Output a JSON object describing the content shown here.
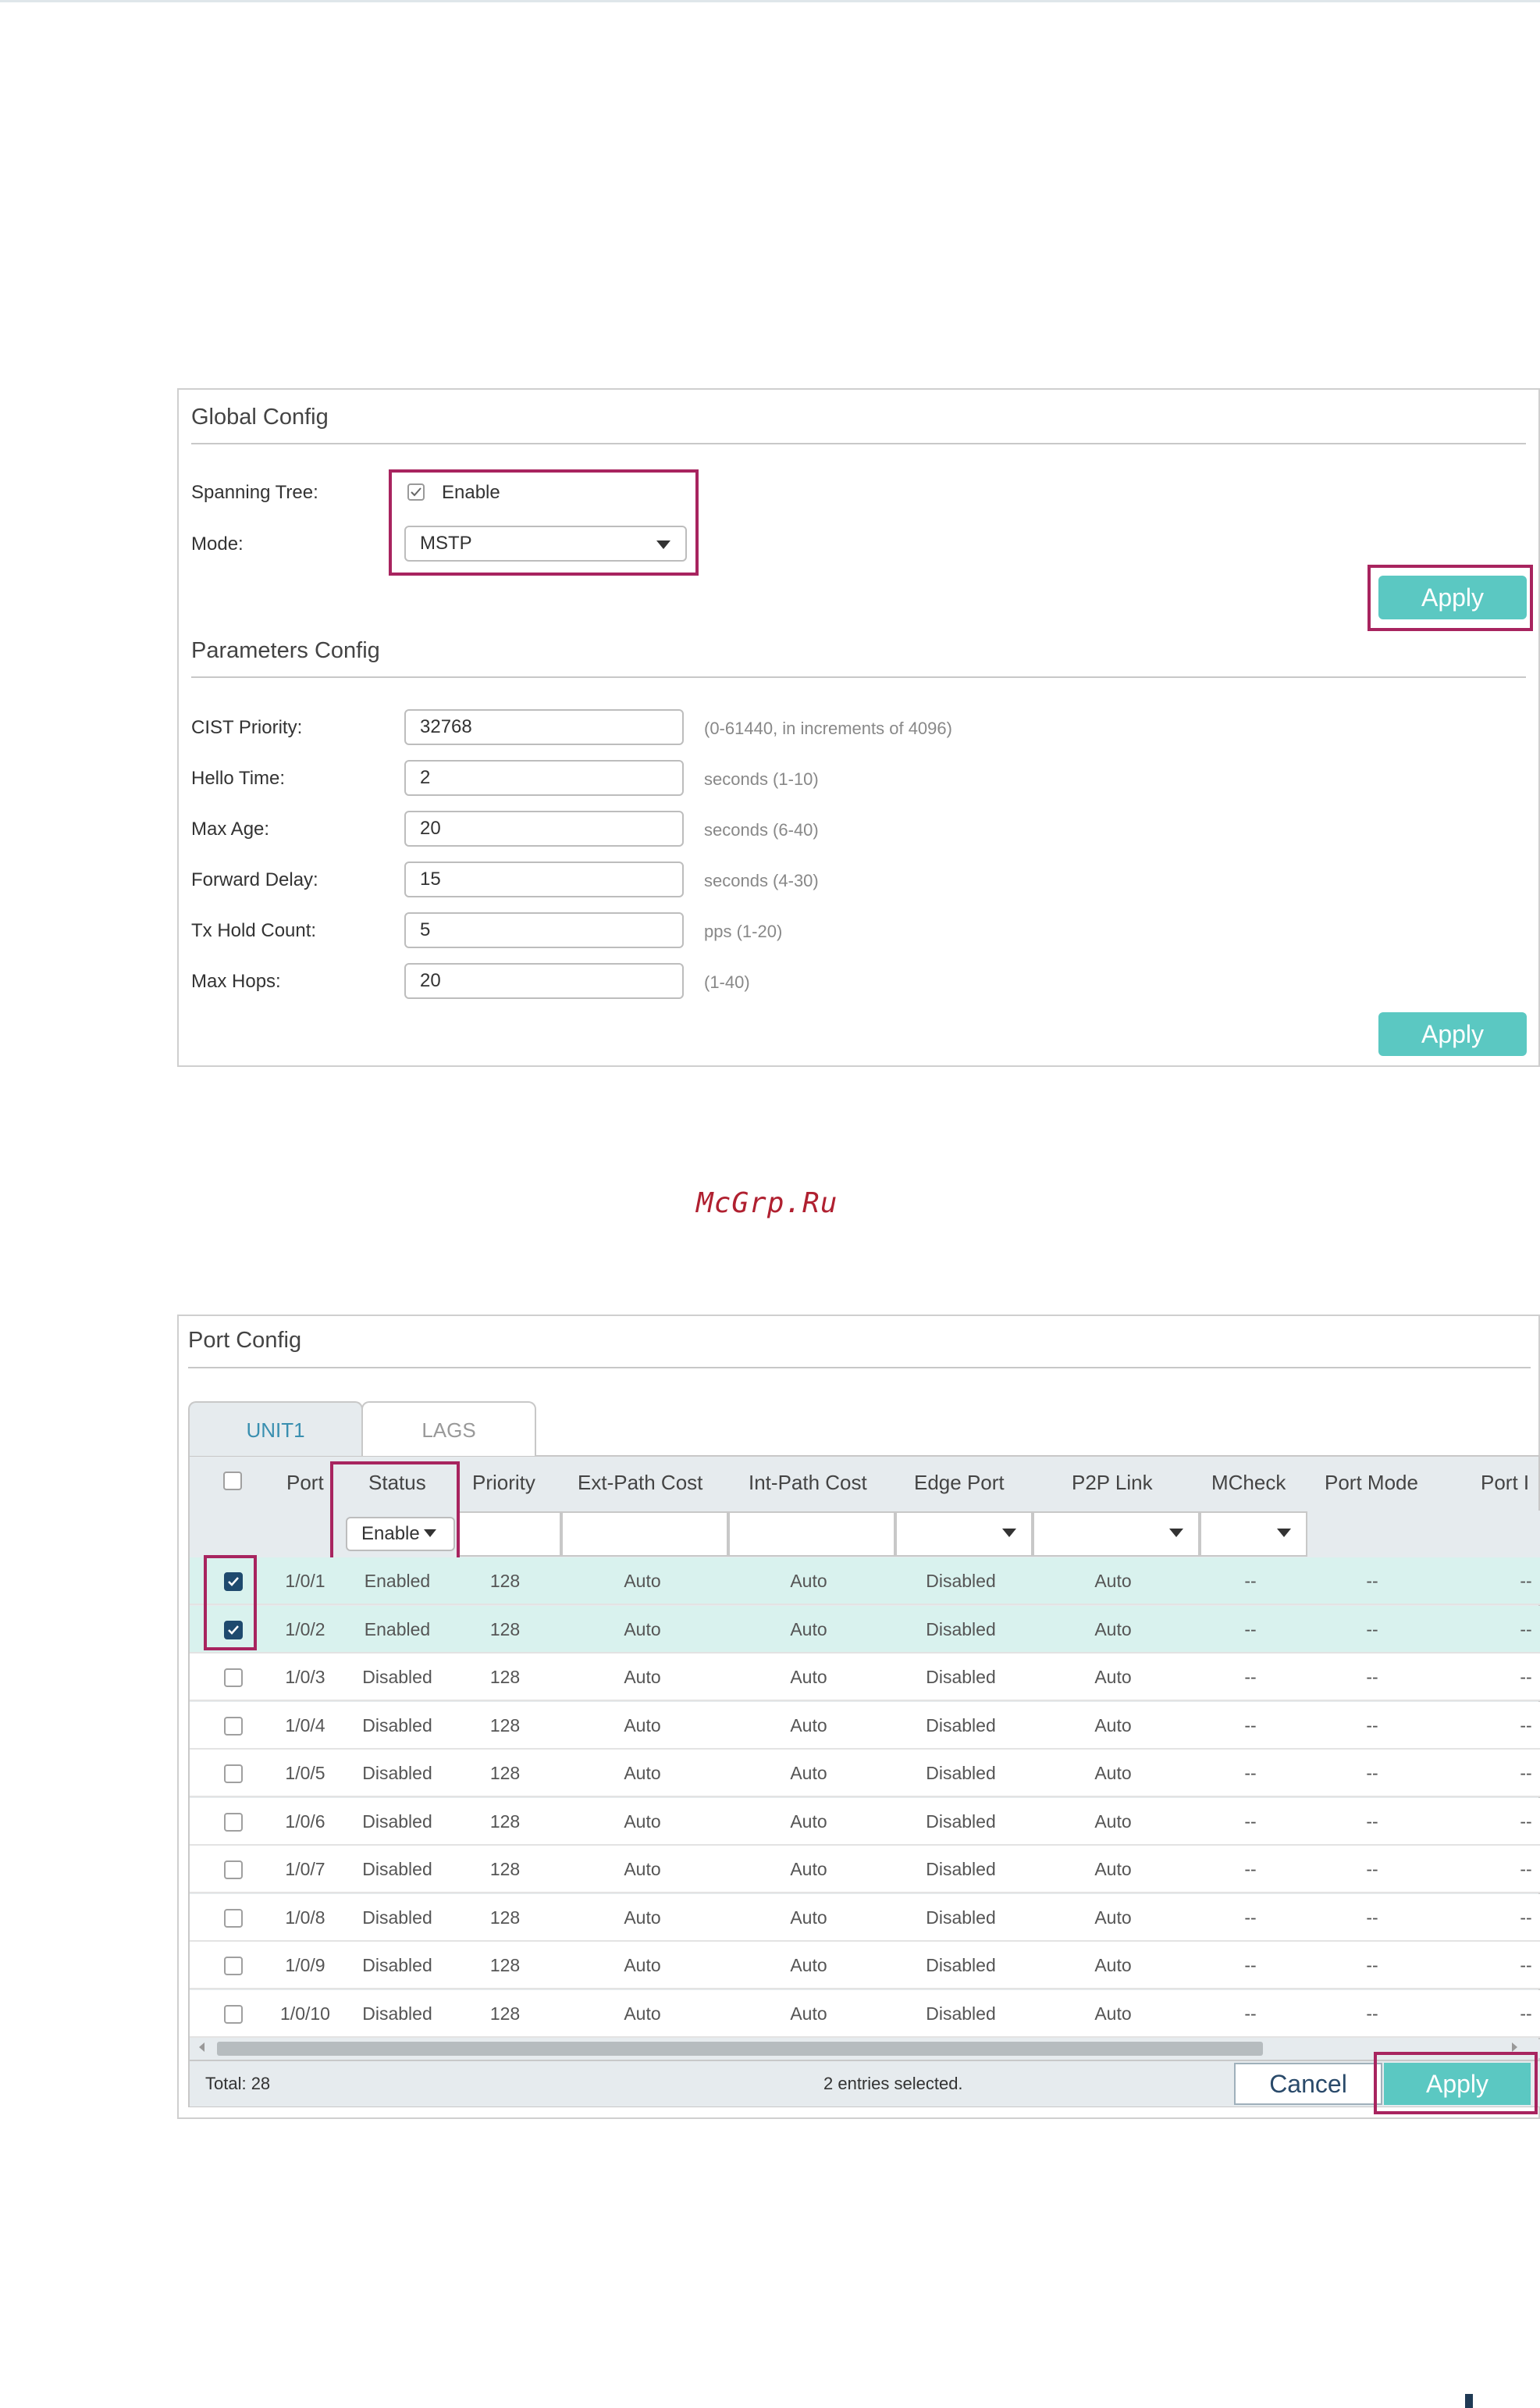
{
  "global_config": {
    "title": "Global Config",
    "spanning_tree_label": "Spanning Tree:",
    "enable_label": "Enable",
    "enable_checked": true,
    "mode_label": "Mode:",
    "mode_value": "MSTP",
    "apply_label": "Apply"
  },
  "parameters_config": {
    "title": "Parameters Config",
    "fields": [
      {
        "label": "CIST Priority:",
        "value": "32768",
        "hint": "(0-61440, in increments of 4096)"
      },
      {
        "label": "Hello Time:",
        "value": "2",
        "hint": "seconds (1-10)"
      },
      {
        "label": "Max Age:",
        "value": "20",
        "hint": "seconds (6-40)"
      },
      {
        "label": "Forward Delay:",
        "value": "15",
        "hint": "seconds (4-30)"
      },
      {
        "label": "Tx Hold Count:",
        "value": "5",
        "hint": "pps (1-20)"
      },
      {
        "label": "Max Hops:",
        "value": "20",
        "hint": "(1-40)"
      }
    ],
    "apply_label": "Apply"
  },
  "watermark": "McGrp.Ru",
  "port_config": {
    "title": "Port Config",
    "tabs": [
      "UNIT1",
      "LAGS"
    ],
    "active_tab": "UNIT1",
    "columns": [
      "Port",
      "Status",
      "Priority",
      "Ext-Path Cost",
      "Int-Path Cost",
      "Edge Port",
      "P2P Link",
      "MCheck",
      "Port Mode",
      "Port I"
    ],
    "status_filter_value": "Enablе",
    "rows": [
      {
        "selected": true,
        "port": "1/0/1",
        "status": "Enabled",
        "priority": "128",
        "ext": "Auto",
        "int": "Auto",
        "edge": "Disabled",
        "p2p": "Auto",
        "mcheck": "--",
        "mode": "--",
        "porti": "--"
      },
      {
        "selected": true,
        "port": "1/0/2",
        "status": "Enabled",
        "priority": "128",
        "ext": "Auto",
        "int": "Auto",
        "edge": "Disabled",
        "p2p": "Auto",
        "mcheck": "--",
        "mode": "--",
        "porti": "--"
      },
      {
        "selected": false,
        "port": "1/0/3",
        "status": "Disabled",
        "priority": "128",
        "ext": "Auto",
        "int": "Auto",
        "edge": "Disabled",
        "p2p": "Auto",
        "mcheck": "--",
        "mode": "--",
        "porti": "--"
      },
      {
        "selected": false,
        "port": "1/0/4",
        "status": "Disabled",
        "priority": "128",
        "ext": "Auto",
        "int": "Auto",
        "edge": "Disabled",
        "p2p": "Auto",
        "mcheck": "--",
        "mode": "--",
        "porti": "--"
      },
      {
        "selected": false,
        "port": "1/0/5",
        "status": "Disabled",
        "priority": "128",
        "ext": "Auto",
        "int": "Auto",
        "edge": "Disabled",
        "p2p": "Auto",
        "mcheck": "--",
        "mode": "--",
        "porti": "--"
      },
      {
        "selected": false,
        "port": "1/0/6",
        "status": "Disabled",
        "priority": "128",
        "ext": "Auto",
        "int": "Auto",
        "edge": "Disabled",
        "p2p": "Auto",
        "mcheck": "--",
        "mode": "--",
        "porti": "--"
      },
      {
        "selected": false,
        "port": "1/0/7",
        "status": "Disabled",
        "priority": "128",
        "ext": "Auto",
        "int": "Auto",
        "edge": "Disabled",
        "p2p": "Auto",
        "mcheck": "--",
        "mode": "--",
        "porti": "--"
      },
      {
        "selected": false,
        "port": "1/0/8",
        "status": "Disabled",
        "priority": "128",
        "ext": "Auto",
        "int": "Auto",
        "edge": "Disabled",
        "p2p": "Auto",
        "mcheck": "--",
        "mode": "--",
        "porti": "--"
      },
      {
        "selected": false,
        "port": "1/0/9",
        "status": "Disabled",
        "priority": "128",
        "ext": "Auto",
        "int": "Auto",
        "edge": "Disabled",
        "p2p": "Auto",
        "mcheck": "--",
        "mode": "--",
        "porti": "--"
      },
      {
        "selected": false,
        "port": "1/0/10",
        "status": "Disabled",
        "priority": "128",
        "ext": "Auto",
        "int": "Auto",
        "edge": "Disabled",
        "p2p": "Auto",
        "mcheck": "--",
        "mode": "--",
        "porti": "--"
      }
    ],
    "total_label": "Total: 28",
    "selected_label": "2 entries selected.",
    "cancel_label": "Cancel",
    "apply_label": "Apply"
  },
  "colors": {
    "accent": "#5bc8c2",
    "highlight_box": "#a8245f",
    "selected_row": "#d9f2ee",
    "checkbox_checked": "#1f4a6e"
  }
}
